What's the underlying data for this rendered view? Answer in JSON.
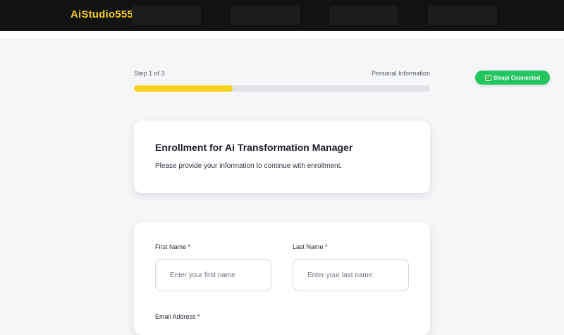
{
  "header": {
    "brand": "AiStudio555",
    "nav_items": [
      "",
      "",
      "",
      ""
    ]
  },
  "progress": {
    "step_label": "Step 1 of 3",
    "step_name": "Personal Information",
    "fraction": 0.333,
    "fill_color": "#f6d31c"
  },
  "status": {
    "label": "Strapi Connected",
    "icon": "check-box-icon",
    "color": "#22c55e"
  },
  "intro": {
    "title": "Enrollment for Ai Transformation Manager",
    "description": "Please provide your information to continue with enrollment."
  },
  "form": {
    "first_name": {
      "label": "First Name *",
      "placeholder": "Enter your first name",
      "value": ""
    },
    "last_name": {
      "label": "Last Name *",
      "placeholder": "Enter your last name",
      "value": ""
    },
    "email": {
      "label": "Email Address *"
    }
  },
  "colors": {
    "brand": "#f3cd1c",
    "topbar": "#121212",
    "background": "#f5f6f8"
  }
}
